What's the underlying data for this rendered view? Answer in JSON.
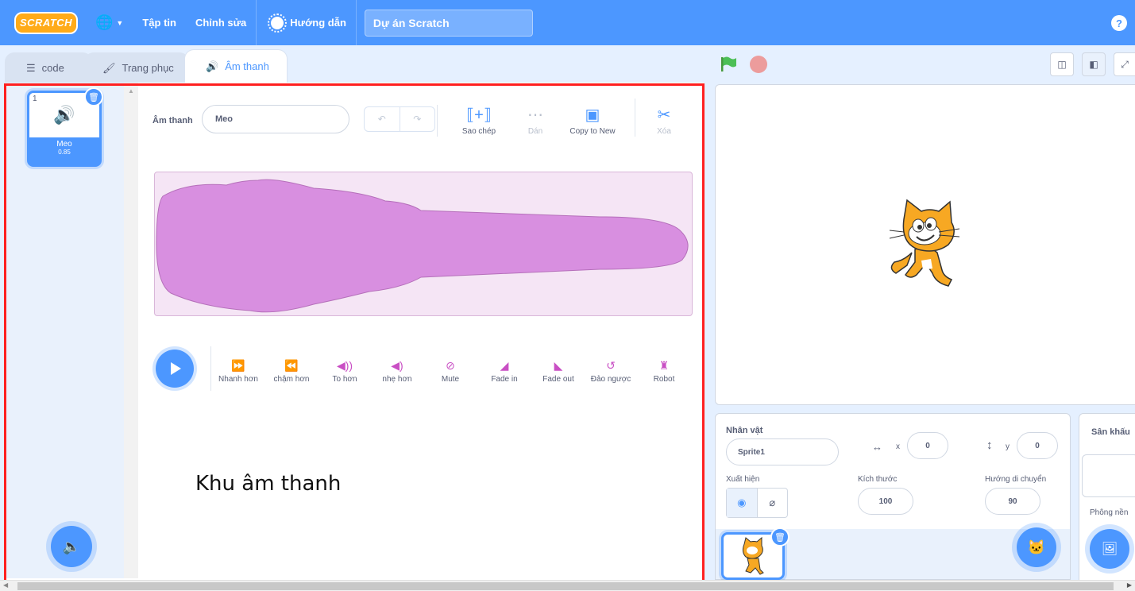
{
  "menubar": {
    "logo": "SCRATCH",
    "file_label": "Tập tin",
    "edit_label": "Chỉnh sửa",
    "tutorials_label": "Hướng dẫn",
    "project_title": "Dự án Scratch",
    "help_symbol": "?"
  },
  "tabs": [
    {
      "label": "code",
      "icon": "code-blocks-icon"
    },
    {
      "label": "Trang phục",
      "icon": "paintbrush-icon"
    },
    {
      "label": "Âm thanh",
      "icon": "speaker-icon",
      "active": true
    }
  ],
  "sound_list": {
    "items": [
      {
        "index": "1",
        "name": "Meo",
        "duration": "0.85",
        "selected": true
      }
    ]
  },
  "sound_editor": {
    "name_label": "Âm thanh",
    "name_value": "Meo",
    "tools": [
      {
        "label": "Sao chép",
        "icon": "copy-icon",
        "enabled": true
      },
      {
        "label": "Dán",
        "icon": "paste-icon",
        "enabled": false
      },
      {
        "label": "Copy to New",
        "icon": "copy-to-new-icon",
        "enabled": true
      },
      {
        "label": "Xóa",
        "icon": "scissors-icon",
        "enabled": false
      }
    ],
    "effects": [
      {
        "label": "Nhanh hơn",
        "icon": "faster-icon"
      },
      {
        "label": "chậm hơn",
        "icon": "slower-icon"
      },
      {
        "label": "To hơn",
        "icon": "louder-icon"
      },
      {
        "label": "nhẹ hơn",
        "icon": "softer-icon"
      },
      {
        "label": "Mute",
        "icon": "mute-icon"
      },
      {
        "label": "Fade in",
        "icon": "fade-in-icon"
      },
      {
        "label": "Fade out",
        "icon": "fade-out-icon"
      },
      {
        "label": "Đảo ngược",
        "icon": "reverse-icon"
      },
      {
        "label": "Robot",
        "icon": "robot-icon"
      }
    ],
    "waveform_color": "#cf63cf"
  },
  "annotation": {
    "text": "Khu âm thanh",
    "frame_color": "#ff2020"
  },
  "sprite_info": {
    "sprite_label": "Nhân vật",
    "sprite_name": "Sprite1",
    "x_label": "x",
    "x_value": "0",
    "y_label": "y",
    "y_value": "0",
    "show_label": "Xuất hiện",
    "size_label": "Kích thước",
    "size_value": "100",
    "direction_label": "Hướng di chuyển",
    "direction_value": "90"
  },
  "stage_pane": {
    "title": "Sân khấu",
    "backdrops_label": "Phông nền"
  },
  "colors": {
    "accent": "#4c97ff",
    "sound_effect": "#cf63cf"
  }
}
